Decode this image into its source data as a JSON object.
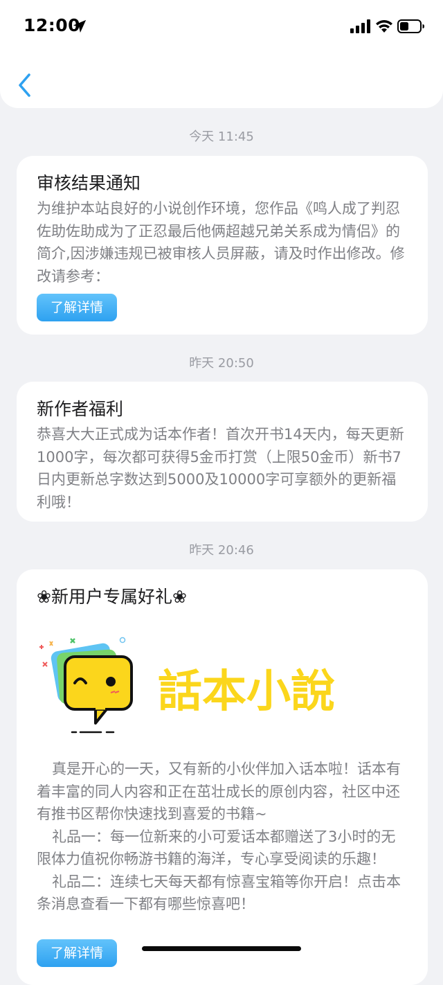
{
  "status_bar": {
    "time": "12:00"
  },
  "messages": [
    {
      "time": "今天 11:45",
      "title": "审核结果通知",
      "body": "为维护本站良好的小说创作环境，您作品《鸣人成了判忍佐助佐助成为了正忍最后他俩超越兄弟关系成为情侣》的简介,因涉嫌违规已被审核人员屏蔽，请及时作出修改。修改请参考：",
      "button": "了解详情"
    },
    {
      "time": "昨天 20:50",
      "title": "新作者福利",
      "body": "恭喜大大正式成为话本作者！首次开书14天内，每天更新1000字，每次都可获得5金币打赏（上限50金币）新书7日内更新总字数达到5000及10000字可享额外的更新福利哦！"
    },
    {
      "time": "昨天 20:46",
      "title": "❀新用户专属好礼❀",
      "banner_text": "話本小說",
      "paragraphs": [
        "真是开心的一天，又有新的小伙伴加入话本啦！话本有着丰富的同人内容和正在茁壮成长的原创内容，社区中还有推书区帮你快速找到喜爱的书籍~",
        "礼品一：每一位新来的小可爱话本都赠送了3小时的无限体力值祝你畅游书籍的海洋，专心享受阅读的乐趣！",
        "礼品二：连续七天每天都有惊喜宝箱等你开启！点击本条消息查看一下都有哪些惊喜吧！"
      ],
      "button": "了解详情"
    }
  ],
  "colors": {
    "accent": "#2ea1f0",
    "background": "#f1f2f5",
    "logo_yellow": "#fbd61c"
  },
  "icons": [
    "location-arrow-icon",
    "signal-icon",
    "wifi-icon",
    "battery-icon",
    "back-chevron-icon"
  ]
}
